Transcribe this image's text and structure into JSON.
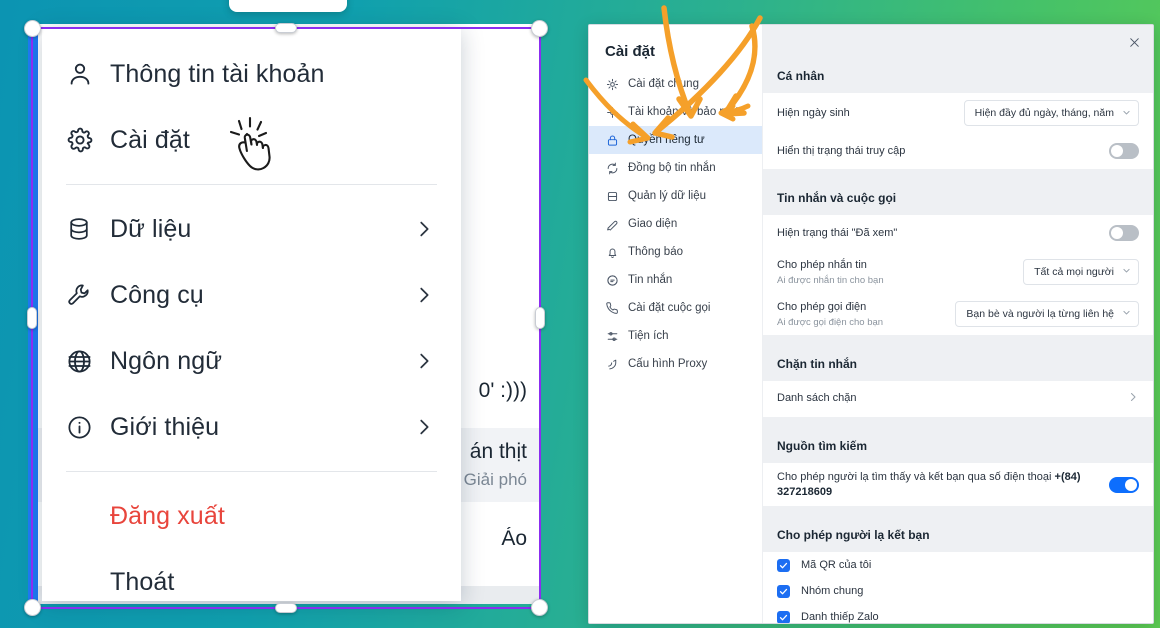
{
  "background": {
    "gradient_from": "#0c94b2",
    "gradient_to": "#5ccb53",
    "app_rail_color": "#1e7bf5"
  },
  "underlying_window": {
    "rows": [
      {
        "line1": "0' :)))",
        "line2": ""
      },
      {
        "line1": "án thịt",
        "line2": "Giải phó"
      },
      {
        "line1": "Áo",
        "line2": ""
      }
    ]
  },
  "context_menu": {
    "items": [
      {
        "icon": "user-icon",
        "label": "Thông tin tài khoản",
        "has_arrow": false,
        "danger": false
      },
      {
        "icon": "gear-icon",
        "label": "Cài đặt",
        "has_arrow": false,
        "danger": false
      },
      {
        "separator": true
      },
      {
        "icon": "database-icon",
        "label": "Dữ liệu",
        "has_arrow": true,
        "danger": false
      },
      {
        "icon": "wrench-icon",
        "label": "Công cụ",
        "has_arrow": true,
        "danger": false
      },
      {
        "icon": "globe-icon",
        "label": "Ngôn ngữ",
        "has_arrow": true,
        "danger": false
      },
      {
        "icon": "info-icon",
        "label": "Giới thiệu",
        "has_arrow": true,
        "danger": false
      },
      {
        "separator": true
      },
      {
        "icon": "",
        "label": "Đăng xuất",
        "has_arrow": false,
        "danger": true
      },
      {
        "icon": "",
        "label": "Thoát",
        "has_arrow": false,
        "danger": false
      }
    ]
  },
  "selection": {
    "border_color": "#8b2df0",
    "handle_color": "#ffffff"
  },
  "settings": {
    "title": "Cài đặt",
    "close_label": "✕",
    "nav": [
      {
        "icon": "gear-icon",
        "label": "Cài đặt chung",
        "active": false
      },
      {
        "icon": "shield-user-icon",
        "label": "Tài khoản và bảo mật",
        "active": false
      },
      {
        "icon": "lock-icon",
        "label": "Quyền riêng tư",
        "active": true
      },
      {
        "icon": "sync-icon",
        "label": "Đồng bộ tin nhắn",
        "active": false
      },
      {
        "icon": "database-icon",
        "label": "Quản lý dữ liệu",
        "active": false
      },
      {
        "icon": "palette-icon",
        "label": "Giao diện",
        "active": false
      },
      {
        "icon": "bell-icon",
        "label": "Thông báo",
        "active": false
      },
      {
        "icon": "chat-icon",
        "label": "Tin nhắn",
        "active": false
      },
      {
        "icon": "phone-icon",
        "label": "Cài đặt cuộc gọi",
        "active": false
      },
      {
        "icon": "sliders-icon",
        "label": "Tiện ích",
        "active": false
      },
      {
        "icon": "proxy-icon",
        "label": "Cấu hình Proxy",
        "active": false
      }
    ],
    "sections": [
      {
        "title": "Cá nhân",
        "rows": [
          {
            "type": "select",
            "label": "Hiện ngày sinh",
            "sub": "",
            "value": "Hiện đầy đủ ngày, tháng, năm"
          },
          {
            "type": "toggle",
            "label": "Hiển thị trạng thái truy cập",
            "sub": "",
            "on": false
          }
        ]
      },
      {
        "title": "Tin nhắn và cuộc gọi",
        "rows": [
          {
            "type": "toggle",
            "label": "Hiện trạng thái \"Đã xem\"",
            "sub": "",
            "on": false
          },
          {
            "type": "select",
            "label": "Cho phép nhắn tin",
            "sub": "Ai được nhắn tin cho bạn",
            "value": "Tất cả mọi người"
          },
          {
            "type": "select",
            "label": "Cho phép gọi điện",
            "sub": "Ai được gọi điện cho bạn",
            "value": "Bạn bè và người lạ từng liên hệ"
          }
        ]
      },
      {
        "title": "Chặn tin nhắn",
        "rows": [
          {
            "type": "nav",
            "label": "Danh sách chặn",
            "sub": ""
          }
        ]
      },
      {
        "title": "Nguồn tìm kiếm",
        "rows": [
          {
            "type": "toggle_phone",
            "label": "Cho phép người lạ tìm thấy và kết bạn qua số điện thoại",
            "phone": "+(84) 327218609",
            "on": true
          }
        ]
      },
      {
        "title": "Cho phép người lạ kết bạn",
        "rows": [
          {
            "type": "check",
            "label": "Mã QR của tôi",
            "checked": true
          },
          {
            "type": "check",
            "label": "Nhóm chung",
            "checked": true
          },
          {
            "type": "check",
            "label": "Danh thiếp Zalo",
            "checked": true
          }
        ]
      }
    ]
  },
  "annotations": {
    "arrow_color": "#f5A02a",
    "arrow_count": 4,
    "target_label": "Quyền riêng tư"
  }
}
